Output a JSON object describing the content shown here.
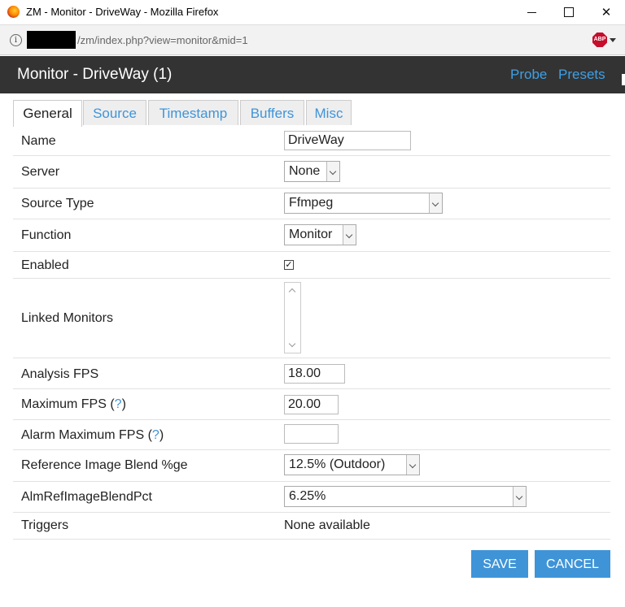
{
  "window": {
    "title": "ZM - Monitor - DriveWay - Mozilla Firefox",
    "minimize": "",
    "maximize": "",
    "close": "✕"
  },
  "urlbar": {
    "url": "/zm/index.php?view=monitor&mid=1",
    "abp_label": "ABP"
  },
  "header": {
    "title": "Monitor - DriveWay (1)",
    "probe": "Probe",
    "presets": "Presets"
  },
  "tabs": [
    {
      "label": "General",
      "active": true
    },
    {
      "label": "Source",
      "active": false
    },
    {
      "label": "Timestamp",
      "active": false
    },
    {
      "label": "Buffers",
      "active": false
    },
    {
      "label": "Misc",
      "active": false
    }
  ],
  "form": {
    "name": {
      "label": "Name",
      "value": "DriveWay"
    },
    "server": {
      "label": "Server",
      "value": "None"
    },
    "source_type": {
      "label": "Source Type",
      "value": "Ffmpeg"
    },
    "function": {
      "label": "Function",
      "value": "Monitor"
    },
    "enabled": {
      "label": "Enabled",
      "checked": true,
      "mark": "✓"
    },
    "linked_monitors": {
      "label": "Linked Monitors"
    },
    "analysis_fps": {
      "label": "Analysis FPS",
      "value": "18.00"
    },
    "maximum_fps": {
      "label_pre": "Maximum FPS (",
      "help": "?",
      "label_post": ")",
      "value": "20.00"
    },
    "alarm_maximum_fps": {
      "label_pre": "Alarm Maximum FPS (",
      "help": "?",
      "label_post": ")",
      "value": ""
    },
    "ref_blend": {
      "label": "Reference Image Blend %ge",
      "value": "12.5% (Outdoor)"
    },
    "alm_ref_blend": {
      "label": "AlmRefImageBlendPct",
      "value": "6.25%"
    },
    "triggers": {
      "label": "Triggers",
      "value": "None available"
    }
  },
  "buttons": {
    "save": "SAVE",
    "cancel": "CANCEL"
  }
}
